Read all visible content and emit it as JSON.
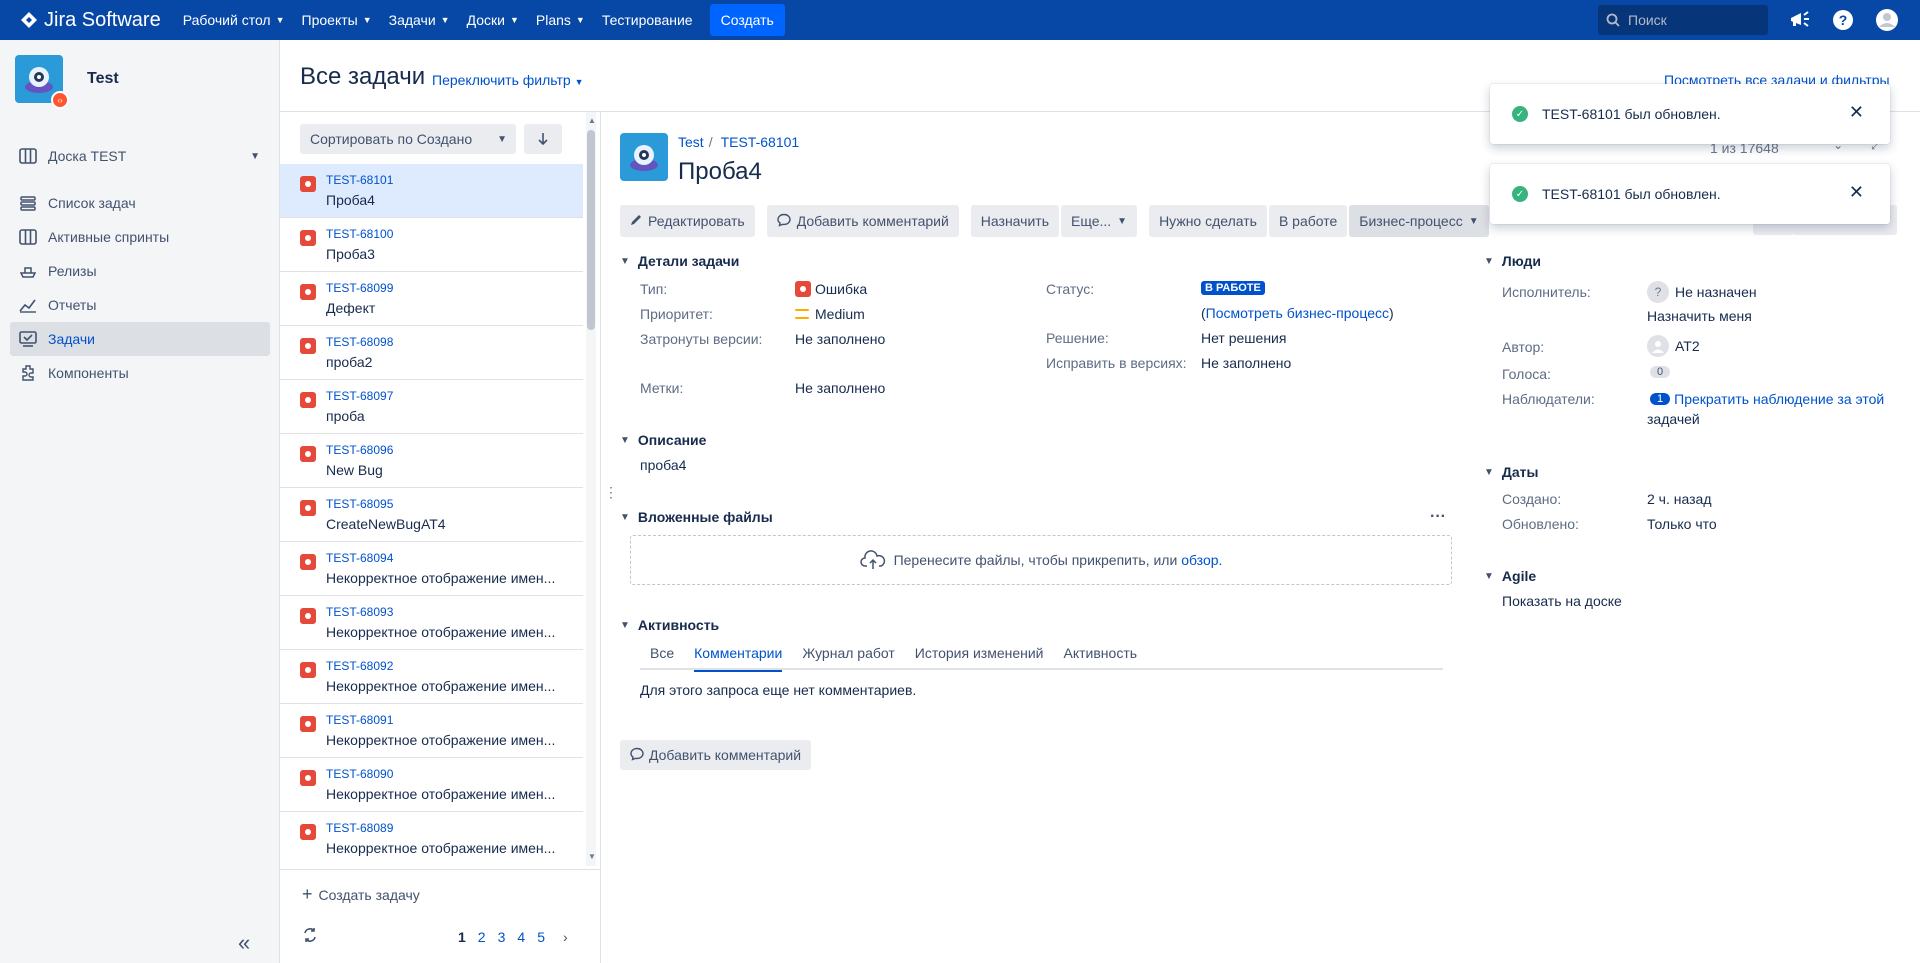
{
  "topnav": {
    "logo_text": "Jira Software",
    "items": [
      {
        "label": "Рабочий стол"
      },
      {
        "label": "Проекты"
      },
      {
        "label": "Задачи"
      },
      {
        "label": "Доски"
      },
      {
        "label": "Plans"
      },
      {
        "label": "Тестирование"
      }
    ],
    "create_label": "Создать",
    "search_placeholder": "Поиск",
    "brand_color": "#0747a6"
  },
  "sidebar": {
    "project_name": "Test",
    "board_label": "Доска TEST",
    "items": [
      {
        "label": "Список задач",
        "icon": "backlog-icon"
      },
      {
        "label": "Активные спринты",
        "icon": "board-icon"
      },
      {
        "label": "Релизы",
        "icon": "ship-icon"
      },
      {
        "label": "Отчеты",
        "icon": "graph-icon"
      },
      {
        "label": "Задачи",
        "icon": "issues-icon",
        "active": true
      },
      {
        "label": "Компоненты",
        "icon": "component-icon"
      }
    ]
  },
  "header": {
    "title": "Все задачи",
    "switch_filter": "Переключить фильтр",
    "view_all": "Посмотреть все задачи и фильтры"
  },
  "list": {
    "sort_label": "Сортировать по Создано",
    "issues": [
      {
        "key": "TEST-68101",
        "summary": "Проба4"
      },
      {
        "key": "TEST-68100",
        "summary": "Проба3"
      },
      {
        "key": "TEST-68099",
        "summary": "Дефект"
      },
      {
        "key": "TEST-68098",
        "summary": "проба2"
      },
      {
        "key": "TEST-68097",
        "summary": "проба"
      },
      {
        "key": "TEST-68096",
        "summary": "New Bug"
      },
      {
        "key": "TEST-68095",
        "summary": "CreateNewBugAT4"
      },
      {
        "key": "TEST-68094",
        "summary": "Некорректное отображение имен..."
      },
      {
        "key": "TEST-68093",
        "summary": "Некорректное отображение имен..."
      },
      {
        "key": "TEST-68092",
        "summary": "Некорректное отображение имен..."
      },
      {
        "key": "TEST-68091",
        "summary": "Некорректное отображение имен..."
      },
      {
        "key": "TEST-68090",
        "summary": "Некорректное отображение имен..."
      },
      {
        "key": "TEST-68089",
        "summary": "Некорректное отображение имен..."
      }
    ],
    "create_issue": "Создать задачу",
    "pages": [
      "1",
      "2",
      "3",
      "4",
      "5"
    ]
  },
  "issue": {
    "project": "Test",
    "key": "TEST-68101",
    "title": "Проба4",
    "position": "1 из 17648",
    "toolbar": {
      "edit": "Редактировать",
      "comment": "Добавить комментарий",
      "assign": "Назначить",
      "more": "Еще...",
      "todo": "Нужно сделать",
      "in_progress": "В работе",
      "workflow": "Бизнес-процесс"
    },
    "details": {
      "heading": "Детали задачи",
      "type_label": "Тип:",
      "type_value": "Ошибка",
      "priority_label": "Приоритет:",
      "priority_value": "Medium",
      "affects_label": "Затронуты версии:",
      "affects_value": "Не заполнено",
      "labels_label": "Метки:",
      "labels_value": "Не заполнено",
      "status_label": "Статус:",
      "status_value": "В РАБОТЕ",
      "workflow_open": "(",
      "workflow_link": "Посмотреть бизнес-процесс",
      "workflow_close": ")",
      "resolution_label": "Решение:",
      "resolution_value": "Нет решения",
      "fix_label": "Исправить в версиях:",
      "fix_value": "Не заполнено"
    },
    "description": {
      "heading": "Описание",
      "text": "проба4"
    },
    "attachments": {
      "heading": "Вложенные файлы",
      "drop_text": "Перенесите файлы, чтобы прикрепить, или",
      "browse": "обзор."
    },
    "activity": {
      "heading": "Активность",
      "tabs": [
        "Все",
        "Комментарии",
        "Журнал работ",
        "История изменений",
        "Активность"
      ],
      "active_tab": "Комментарии",
      "empty": "Для этого запроса еще нет комментариев.",
      "add_comment": "Добавить комментарий"
    },
    "people": {
      "heading": "Люди",
      "assignee_label": "Исполнитель:",
      "assignee_value": "Не назначен",
      "assign_me": "Назначить меня",
      "reporter_label": "Автор:",
      "reporter_value": "AT2",
      "votes_label": "Голоса:",
      "votes_value": "0",
      "watchers_label": "Наблюдатели:",
      "watchers_count": "1",
      "watch_line1": "Прекратить наблюдение за этой",
      "watch_line2": "задачей"
    },
    "dates": {
      "heading": "Даты",
      "created_label": "Создано:",
      "created_value": "2 ч. назад",
      "updated_label": "Обновлено:",
      "updated_value": "Только что"
    },
    "agile": {
      "heading": "Agile",
      "link": "Показать на доске"
    }
  },
  "toasts": [
    {
      "text": "TEST-68101 был обновлен."
    },
    {
      "text": "TEST-68101 был обновлен."
    }
  ]
}
